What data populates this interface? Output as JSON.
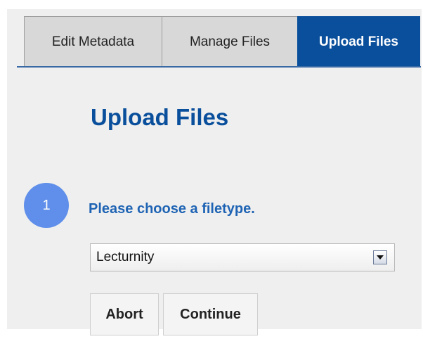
{
  "tabs": [
    {
      "label": "Edit Metadata",
      "active": false
    },
    {
      "label": "Manage Files",
      "active": false
    },
    {
      "label": "Upload Files",
      "active": true
    }
  ],
  "page_title": "Upload Files",
  "step": {
    "number": "1",
    "text": "Please choose a filetype."
  },
  "filetype_select": {
    "selected": "Lecturnity"
  },
  "buttons": {
    "abort": "Abort",
    "continue": "Continue"
  },
  "colors": {
    "accent": "#0a4f9c",
    "step_circle": "#5f8fea",
    "panel_bg": "#efefef"
  }
}
